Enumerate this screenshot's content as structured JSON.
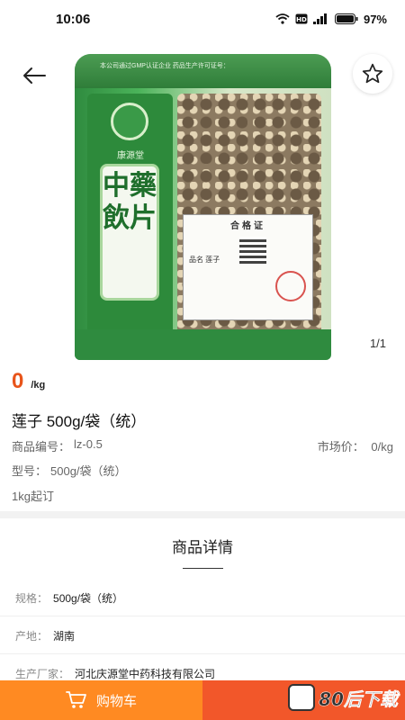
{
  "status_bar": {
    "time": "10:06",
    "battery": "97%"
  },
  "gallery": {
    "counter": "1/1",
    "bag_brand": "康源堂",
    "bag_label": "中藥飲片",
    "bag_top_text": "本公司通过GMP认证企业     药品生产许可证号：",
    "cert_title": "合格证",
    "cert_product": "品名 莲子"
  },
  "product": {
    "price": "0",
    "price_unit": "/kg",
    "title": "莲子 500g/袋（统）",
    "code_label": "商品编号：",
    "code_value": "lz-0.5",
    "market_price_label": "市场价：",
    "market_price_value": "0/kg",
    "model_label": "型号：",
    "model_value": "500g/袋（统）",
    "min_order": "1kg起订"
  },
  "details": {
    "title": "商品详情",
    "rows": [
      {
        "label": "规格：",
        "value": "500g/袋（统）"
      },
      {
        "label": "产地：",
        "value": "湖南"
      },
      {
        "label": "生产厂家：",
        "value": "河北庆源堂中药科技有限公司"
      }
    ]
  },
  "bottom_bar": {
    "cart_label": "购物车",
    "buy_label": "",
    "watermark": "80后下载"
  },
  "colors": {
    "price": "#e8541a",
    "cart": "#ff8a22",
    "buy": "#f2572a"
  }
}
